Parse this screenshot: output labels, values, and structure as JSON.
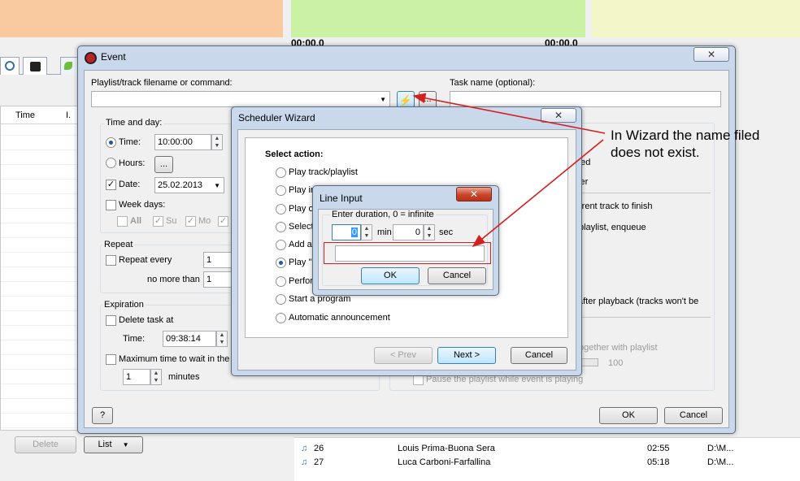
{
  "background": {
    "top_colors": {
      "left": "#f9c9a0",
      "middle": "#c9f2a5",
      "right": "#f3f6c8"
    },
    "timers": [
      "00:00.0",
      "00:00.0"
    ],
    "left_list": {
      "col_time": "Time",
      "col_i": "I."
    },
    "bottom_buttons": {
      "delete": "Delete",
      "list": "List"
    },
    "tracks": [
      {
        "num": "26",
        "title": "Louis Prima-Buona Sera",
        "dur": "02:55",
        "path": "D:\\M..."
      },
      {
        "num": "27",
        "title": "Luca Carboni-Farfallina",
        "dur": "05:18",
        "path": "D:\\M..."
      }
    ]
  },
  "event_window": {
    "title": "Event",
    "close": "✕",
    "playlist_label": "Playlist/track filename or command:",
    "task_label": "Task name (optional):",
    "browse_label": "...",
    "time_group": {
      "title": "Time and day:",
      "time_label": "Time:",
      "time_value": "10:00:00",
      "hours_label": "Hours:",
      "hours_btn": "...",
      "date_label": "Date:",
      "date_value": "25.02.2013",
      "weekdays_label": "Week days:",
      "all": "All",
      "su": "Su",
      "mo": "Mo"
    },
    "repeat_group": {
      "title": "Repeat",
      "repeat_every": "Repeat every",
      "repeat_value": "1",
      "no_more_than": "no more than",
      "no_more_value": "1"
    },
    "expiration_group": {
      "title": "Expiration",
      "delete_task": "Delete task at",
      "time_label": "Time:",
      "time_value": "09:38:14",
      "max_wait": "Maximum time to wait in the q",
      "minutes_value": "1",
      "minutes_label": "minutes"
    },
    "right_panel": {
      "ped": "ped",
      "ver": "ver",
      "current_track": "rrent track to finish",
      "playlist_enqueue": "playlist, enqueue",
      "after_playback": "after playback (tracks won't be",
      "together": "ogether with playlist",
      "volume": "100",
      "pause": "Pause the playlist while event is playing"
    },
    "help": "?",
    "ok": "OK",
    "cancel": "Cancel"
  },
  "wizard_window": {
    "title": "Scheduler Wizard",
    "close": "✕",
    "select_action": "Select action:",
    "options": [
      "Play track/playlist",
      "Play in",
      "Play or",
      "Select",
      "Add all",
      "Play \"L",
      "Perfor",
      "Start a program",
      "Automatic announcement"
    ],
    "prev": "< Prev",
    "next": "Next >",
    "cancel": "Cancel"
  },
  "line_input": {
    "title": "Line Input",
    "close": "✕",
    "prompt": "Enter duration, 0 = infinite",
    "min_value": "0",
    "min_label": "min",
    "sec_value": "0",
    "sec_label": "sec",
    "ok": "OK",
    "cancel": "Cancel"
  },
  "annotation": {
    "text_line1": "In Wizard the name filed",
    "text_line2": "does not exist.",
    "color": "#d61f1f"
  }
}
